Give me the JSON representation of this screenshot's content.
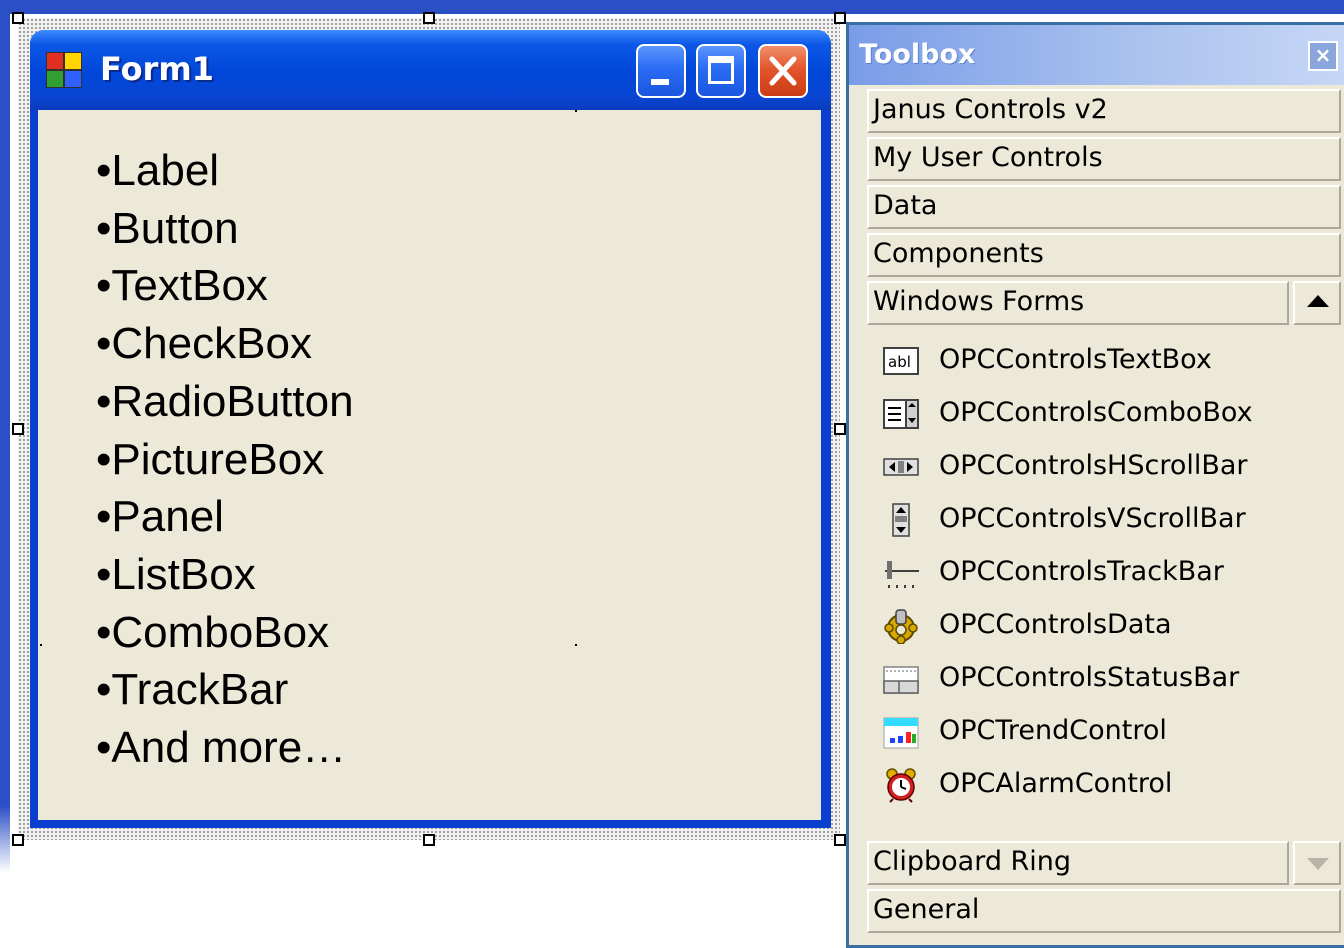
{
  "form": {
    "title": "Form1",
    "controls_list": [
      "•Label",
      "•Button",
      "•TextBox",
      "•CheckBox",
      "•RadioButton",
      "•PictureBox",
      "•Panel",
      "•ListBox",
      "•ComboBox",
      "•TrackBar",
      "•And more…"
    ]
  },
  "toolbox": {
    "title": "Toolbox",
    "close_glyph": "×",
    "tabs": [
      "Janus Controls v2",
      "My User Controls",
      "Data",
      "Components",
      "Windows Forms"
    ],
    "items": [
      {
        "label": "OPCControlsTextBox",
        "icon": "textbox-icon"
      },
      {
        "label": "OPCControlsComboBox",
        "icon": "combobox-icon"
      },
      {
        "label": "OPCControlsHScrollBar",
        "icon": "hscrollbar-icon"
      },
      {
        "label": "OPCControlsVScrollBar",
        "icon": "vscrollbar-icon"
      },
      {
        "label": "OPCControlsTrackBar",
        "icon": "trackbar-icon"
      },
      {
        "label": "OPCControlsData",
        "icon": "data-gear-icon"
      },
      {
        "label": "OPCControlsStatusBar",
        "icon": "statusbar-icon"
      },
      {
        "label": "OPCTrendControl",
        "icon": "trend-chart-icon"
      },
      {
        "label": "OPCAlarmControl",
        "icon": "alarm-clock-icon"
      }
    ],
    "bottom_tabs": [
      "Clipboard Ring",
      "General"
    ]
  },
  "colors": {
    "titlebar_blue": "#0046d8",
    "client_bg": "#ece9d8",
    "close_red": "#e3562c"
  }
}
